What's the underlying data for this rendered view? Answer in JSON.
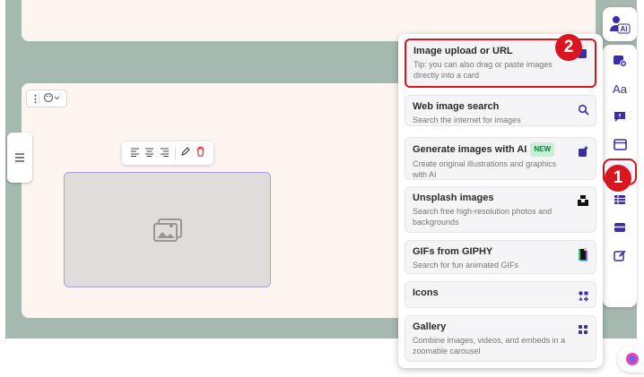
{
  "menu": {
    "items": [
      {
        "title": "Image upload or URL",
        "desc": "Tip: you can also drag or paste images directly into a card",
        "icon": "image-upload-icon",
        "badge": ""
      },
      {
        "title": "Web image search",
        "desc": "Search the internet for images",
        "icon": "search-icon",
        "badge": ""
      },
      {
        "title": "Generate images with AI",
        "desc": "Create original illustrations and graphics with AI",
        "icon": "ai-sparkle-icon",
        "badge": "NEW"
      },
      {
        "title": "Unsplash images",
        "desc": "Search free high-resolution photos and backgrounds",
        "icon": "unsplash-icon",
        "badge": ""
      },
      {
        "title": "GIFs from GIPHY",
        "desc": "Search for fun animated GIFs",
        "icon": "giphy-icon",
        "badge": ""
      },
      {
        "title": "Icons",
        "desc": "",
        "icon": "icons-icon",
        "badge": ""
      },
      {
        "title": "Gallery",
        "desc": "Combine images, videos, and embeds in a zoomable carousel",
        "icon": "gallery-icon",
        "badge": ""
      }
    ]
  },
  "markers": {
    "first": "1",
    "second": "2"
  },
  "rail": {
    "ai_label": "AI",
    "text_label": "Aa",
    "items": [
      "add-card-icon",
      "text-icon",
      "callout-icon",
      "layout-icon",
      "image-icon",
      "table-icon",
      "button-icon",
      "edit-icon"
    ]
  },
  "colors": {
    "accent": "#3b2fa8",
    "highlight": "#d9161f",
    "canvas": "#a6b9b0",
    "card": "#fdf6f0"
  }
}
